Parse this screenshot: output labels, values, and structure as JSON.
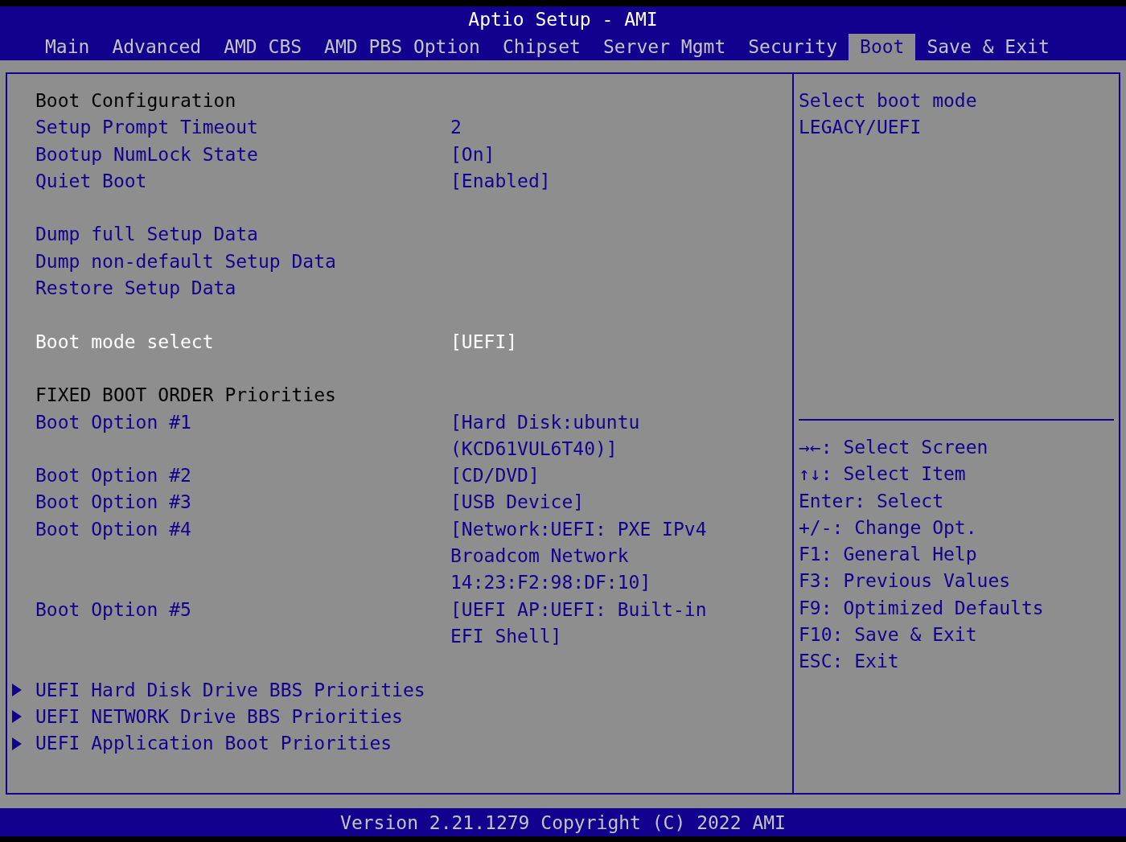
{
  "title": "Aptio Setup - AMI",
  "tabs": [
    {
      "label": "Main",
      "selected": false
    },
    {
      "label": "Advanced",
      "selected": false
    },
    {
      "label": "AMD CBS",
      "selected": false
    },
    {
      "label": "AMD PBS Option",
      "selected": false
    },
    {
      "label": "Chipset",
      "selected": false
    },
    {
      "label": "Server Mgmt",
      "selected": false
    },
    {
      "label": "Security",
      "selected": false
    },
    {
      "label": "Boot",
      "selected": true
    },
    {
      "label": "Save & Exit",
      "selected": false
    }
  ],
  "items": [
    {
      "kind": "header",
      "label": "Boot Configuration"
    },
    {
      "kind": "setting",
      "label": "Setup Prompt Timeout",
      "value": [
        "2"
      ],
      "selected": false
    },
    {
      "kind": "setting",
      "label": "Bootup NumLock State",
      "value": [
        "[On]"
      ],
      "selected": false
    },
    {
      "kind": "setting",
      "label": "Quiet Boot",
      "value": [
        "[Enabled]"
      ],
      "selected": false
    },
    {
      "kind": "spacer"
    },
    {
      "kind": "setting",
      "label": "Dump full Setup Data",
      "selected": false
    },
    {
      "kind": "setting",
      "label": "Dump non-default Setup Data",
      "selected": false
    },
    {
      "kind": "setting",
      "label": "Restore Setup Data",
      "selected": false
    },
    {
      "kind": "spacer"
    },
    {
      "kind": "setting",
      "label": "Boot mode select",
      "value": [
        "[UEFI]"
      ],
      "selected": true
    },
    {
      "kind": "spacer"
    },
    {
      "kind": "header",
      "label": "FIXED BOOT ORDER Priorities"
    },
    {
      "kind": "setting",
      "label": "Boot Option #1",
      "value": [
        "[Hard Disk:ubuntu",
        "(KCD61VUL6T40)]"
      ],
      "selected": false
    },
    {
      "kind": "setting",
      "label": "Boot Option #2",
      "value": [
        "[CD/DVD]"
      ],
      "selected": false
    },
    {
      "kind": "setting",
      "label": "Boot Option #3",
      "value": [
        "[USB Device]"
      ],
      "selected": false
    },
    {
      "kind": "setting",
      "label": "Boot Option #4",
      "value": [
        "[Network:UEFI: PXE IPv4",
        "Broadcom Network",
        "14:23:F2:98:DF:10]"
      ],
      "selected": false
    },
    {
      "kind": "setting",
      "label": "Boot Option #5",
      "value": [
        "[UEFI AP:UEFI: Built-in",
        "EFI Shell]"
      ],
      "selected": false
    },
    {
      "kind": "spacer"
    },
    {
      "kind": "submenu",
      "label": "UEFI Hard Disk Drive BBS Priorities",
      "selected": false
    },
    {
      "kind": "submenu",
      "label": "UEFI NETWORK Drive BBS Priorities",
      "selected": false
    },
    {
      "kind": "submenu",
      "label": "UEFI Application Boot Priorities",
      "selected": false
    }
  ],
  "help": {
    "description": [
      "Select boot mode",
      "LEGACY/UEFI"
    ],
    "keys": [
      "→←: Select Screen",
      "↑↓: Select Item",
      "Enter: Select",
      "+/-: Change Opt.",
      "F1: General Help",
      "F3: Previous Values",
      "F9: Optimized Defaults",
      "F10: Save & Exit",
      "ESC: Exit"
    ]
  },
  "footer": "Version 2.21.1279 Copyright (C) 2022 AMI"
}
